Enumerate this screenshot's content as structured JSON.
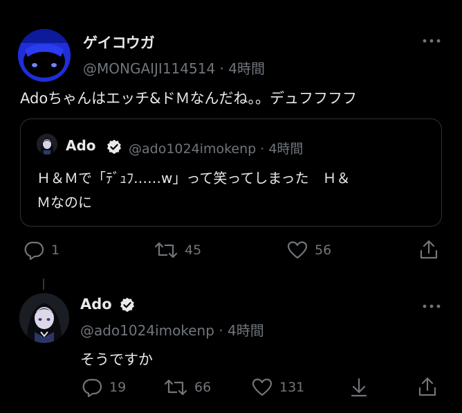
{
  "tweet": {
    "display_name": "ゲイコウガ",
    "handle": "@MONGAIJI114514",
    "time": "4時間",
    "text": "Adoちゃんはエッチ&ドＭなんだね。。デュフフフフ",
    "more_icon": "more-horizontal-icon",
    "quote": {
      "display_name": "Ado",
      "handle": "@ado1024imokenp",
      "time": "4時間",
      "verified_icon": "verified-badge-icon",
      "text_lines": [
        "Ｈ＆Ｍで「ﾃﾞｭﾌ……w」って笑ってしまった　Ｈ＆",
        "Ｍなのに"
      ]
    },
    "actions": {
      "replies": "1",
      "retweets": "45",
      "likes": "56",
      "share_icon": "share-icon"
    }
  },
  "reply": {
    "display_name": "Ado",
    "handle": "@ado1024imokenp",
    "time": "4時間",
    "verified_icon": "verified-badge-icon",
    "text": "そうですか",
    "actions": {
      "replies": "19",
      "retweets": "66",
      "likes": "131",
      "download_icon": "download-icon",
      "share_icon": "share-icon"
    }
  },
  "colors": {
    "background": "#000000",
    "text": "#e7e9ea",
    "secondary_text": "#71767b",
    "border": "#2f3336",
    "avatar_blue": "#1f2ed8"
  }
}
